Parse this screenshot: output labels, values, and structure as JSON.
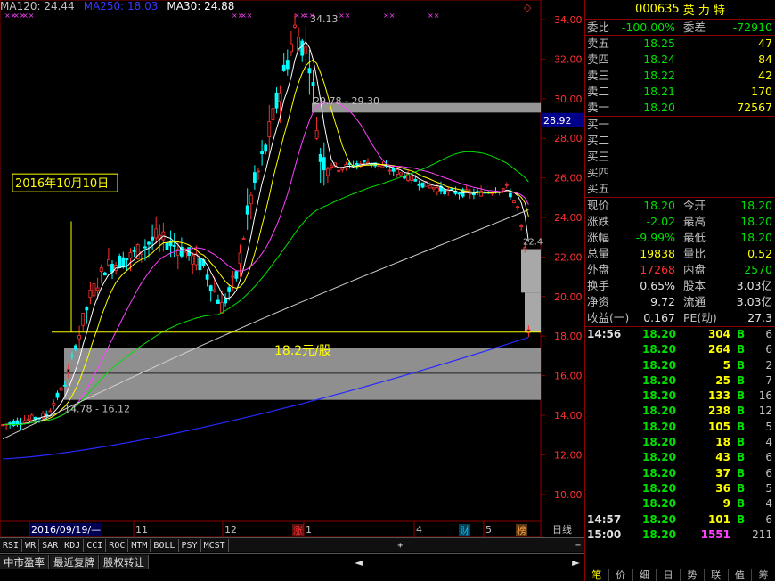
{
  "ma_bar": {
    "ma120": "MA120: 24.44",
    "ma250": "MA250: 18.03",
    "ma30": "MA30: 24.88",
    "ma120_color": "#c0c0c0",
    "ma250_color": "#3030ff",
    "ma30_color": "#ffffff"
  },
  "stock": {
    "code": "000635",
    "name": "英 力 特"
  },
  "book": {
    "weibi_label": "委比",
    "weibi": "-100.00%",
    "weicha_label": "委差",
    "weicha": "-72910",
    "asks": [
      {
        "label": "卖五",
        "price": "18.25",
        "vol": "47"
      },
      {
        "label": "卖四",
        "price": "18.24",
        "vol": "84"
      },
      {
        "label": "卖三",
        "price": "18.22",
        "vol": "42"
      },
      {
        "label": "卖二",
        "price": "18.21",
        "vol": "170"
      },
      {
        "label": "卖一",
        "price": "18.20",
        "vol": "72567"
      }
    ],
    "bids": [
      {
        "label": "买一"
      },
      {
        "label": "买二"
      },
      {
        "label": "买三"
      },
      {
        "label": "买四"
      },
      {
        "label": "买五"
      }
    ]
  },
  "quote": [
    {
      "l1": "现价",
      "v1": "18.20",
      "c1": "g",
      "l2": "今开",
      "v2": "18.20",
      "c2": "g"
    },
    {
      "l1": "涨跌",
      "v1": "-2.02",
      "c1": "g",
      "l2": "最高",
      "v2": "18.20",
      "c2": "g"
    },
    {
      "l1": "涨幅",
      "v1": "-9.99%",
      "c1": "g",
      "l2": "最低",
      "v2": "18.20",
      "c2": "g"
    },
    {
      "l1": "总量",
      "v1": "19838",
      "c1": "y",
      "l2": "量比",
      "v2": "0.52",
      "c2": "y"
    },
    {
      "l1": "外盘",
      "v1": "17268",
      "c1": "r",
      "l2": "内盘",
      "v2": "2570",
      "c2": "g"
    },
    {
      "l1": "换手",
      "v1": "0.65%",
      "c1": "w",
      "l2": "股本",
      "v2": "3.03亿",
      "c2": "w"
    },
    {
      "l1": "净资",
      "v1": "9.72",
      "c1": "w",
      "l2": "流通",
      "v2": "3.03亿",
      "c2": "w"
    },
    {
      "l1": "收益(一)",
      "v1": "0.167",
      "c1": "w",
      "l2": "PE(动)",
      "v2": "27.3",
      "c2": "w"
    }
  ],
  "ticks": [
    {
      "t": "14:56",
      "p": "18.20",
      "v": "304",
      "bs": "B",
      "n": "6"
    },
    {
      "t": "",
      "p": "18.20",
      "v": "264",
      "bs": "B",
      "n": "6"
    },
    {
      "t": "",
      "p": "18.20",
      "v": "5",
      "bs": "B",
      "n": "2"
    },
    {
      "t": "",
      "p": "18.20",
      "v": "25",
      "bs": "B",
      "n": "7"
    },
    {
      "t": "",
      "p": "18.20",
      "v": "133",
      "bs": "B",
      "n": "16"
    },
    {
      "t": "",
      "p": "18.20",
      "v": "238",
      "bs": "B",
      "n": "12"
    },
    {
      "t": "",
      "p": "18.20",
      "v": "105",
      "bs": "B",
      "n": "5"
    },
    {
      "t": "",
      "p": "18.20",
      "v": "18",
      "bs": "B",
      "n": "4"
    },
    {
      "t": "",
      "p": "18.20",
      "v": "43",
      "bs": "B",
      "n": "6"
    },
    {
      "t": "",
      "p": "18.20",
      "v": "37",
      "bs": "B",
      "n": "6"
    },
    {
      "t": "",
      "p": "18.20",
      "v": "36",
      "bs": "B",
      "n": "5"
    },
    {
      "t": "",
      "p": "18.20",
      "v": "9",
      "bs": "B",
      "n": "4"
    },
    {
      "t": "14:57",
      "p": "18.20",
      "v": "101",
      "bs": "B",
      "n": "6"
    },
    {
      "t": "15:00",
      "p": "18.20",
      "v": "1551",
      "bs": "",
      "n": "211"
    }
  ],
  "panel_tabs": [
    "笔",
    "价",
    "细",
    "日",
    "势",
    "联",
    "值",
    "筹"
  ],
  "chart": {
    "y_ticks": [
      "34.00",
      "32.00",
      "30.00",
      "28.00",
      "26.00",
      "24.00",
      "22.00",
      "20.00",
      "18.00",
      "16.00",
      "14.00",
      "12.00",
      "10.00"
    ],
    "current_price_tag": "28.92",
    "high_label": "34.13",
    "gap_label_top": "29.78 - 29.30",
    "gap_label_bottom": "14.78 - 16.12",
    "date_annotation": "2016年10月10日",
    "price_annotation": "18.2元/股",
    "last_label": "22.4",
    "x_labels": [
      "2016/09/19/—",
      "11",
      "12",
      "1",
      "4",
      "5"
    ],
    "period": "日线",
    "markers": [
      "涨",
      "财",
      "榜"
    ]
  },
  "indicators": [
    "RSI",
    "WR",
    "SAR",
    "KDJ",
    "CCI",
    "ROC",
    "MTM",
    "BOLL",
    "PSY",
    "MCST"
  ],
  "bottom_tabs": [
    "中市盈率",
    "最近复牌",
    "股权转让"
  ]
}
